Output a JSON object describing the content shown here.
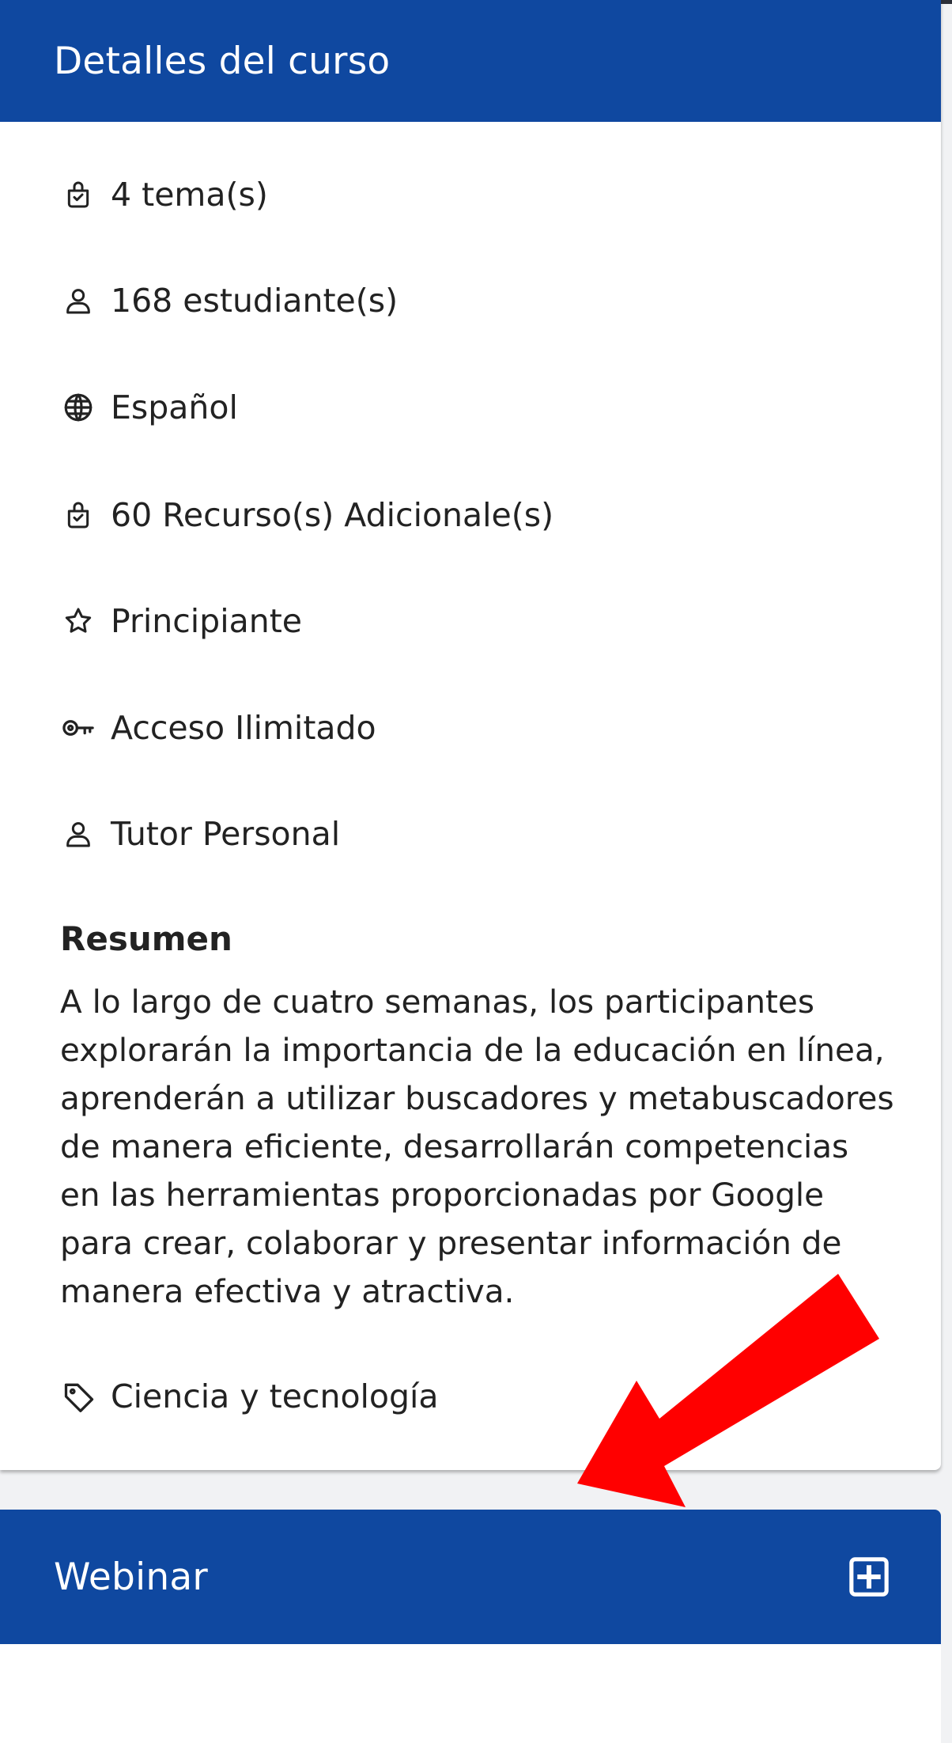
{
  "course_details": {
    "title": "Detalles del curso",
    "items": [
      {
        "icon": "lesson-icon",
        "text": "4 tema(s)"
      },
      {
        "icon": "person-icon",
        "text": "168 estudiante(s)"
      },
      {
        "icon": "globe-icon",
        "text": "Español"
      },
      {
        "icon": "lesson-icon",
        "text": "60 Recurso(s) Adicionale(s)"
      },
      {
        "icon": "star-icon",
        "text": "Principiante"
      },
      {
        "icon": "key-icon",
        "text": "Acceso Ilimitado"
      },
      {
        "icon": "person-icon",
        "text": "Tutor Personal"
      }
    ],
    "summary_title": "Resumen",
    "summary_text": "A lo largo de cuatro semanas, los participantes explorarán la importancia de la educación en línea, aprenderán a utilizar buscadores y metabuscadores de manera eficiente, desarrollarán competencias en las herramientas proporcionadas por Google para crear, colaborar y presentar información de manera efectiva y atractiva.",
    "category": {
      "icon": "tag-icon",
      "text": "Ciencia y tecnología"
    }
  },
  "webinar": {
    "title": "Webinar",
    "expand_icon": "plus-square-icon"
  },
  "annotation": {
    "arrow_icon": "red-arrow-icon",
    "color": "#ff0000"
  },
  "colors": {
    "header_bg": "#0f48a0",
    "header_text": "#ffffff"
  }
}
